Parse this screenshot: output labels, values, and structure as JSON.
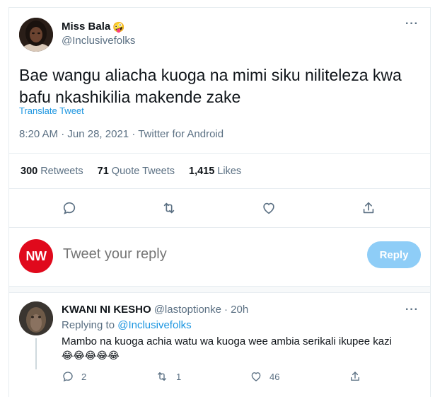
{
  "tweet": {
    "author_name": "Miss Bala",
    "author_emoji": "🤪",
    "handle": "@Inclusivefolks",
    "text": "Bae wangu aliacha kuoga na mimi siku niliteleza kwa bafu nkashikilia makende zake",
    "translate_label": "Translate Tweet",
    "time": "8:20 AM",
    "date": "Jun 28, 2021",
    "source": "Twitter for Android",
    "retweets_count": "300",
    "retweets_label": "Retweets",
    "quotes_count": "71",
    "quotes_label": "Quote Tweets",
    "likes_count": "1,415",
    "likes_label": "Likes",
    "more_glyph": "···"
  },
  "composer": {
    "avatar_text": "NW",
    "placeholder": "Tweet your reply",
    "reply_button": "Reply"
  },
  "reply": {
    "author_name": "KWANI NI KESHO",
    "handle": "@lastoptionke",
    "time": "· 20h",
    "replying_prefix": "Replying to",
    "replying_to": "@Inclusivefolks",
    "text": "Mambo na kuoga achia watu wa kuoga wee ambia serikali ikupee kazi",
    "emojis": "😂😂😂😂😂",
    "reply_count": "2",
    "retweet_count": "1",
    "like_count": "46",
    "more_glyph": "···"
  },
  "colors": {
    "accent": "#1b95e0",
    "secondary_text": "#5b7083",
    "reply_button_disabled": "#8ecdf7",
    "composer_avatar": "#e0091c"
  }
}
